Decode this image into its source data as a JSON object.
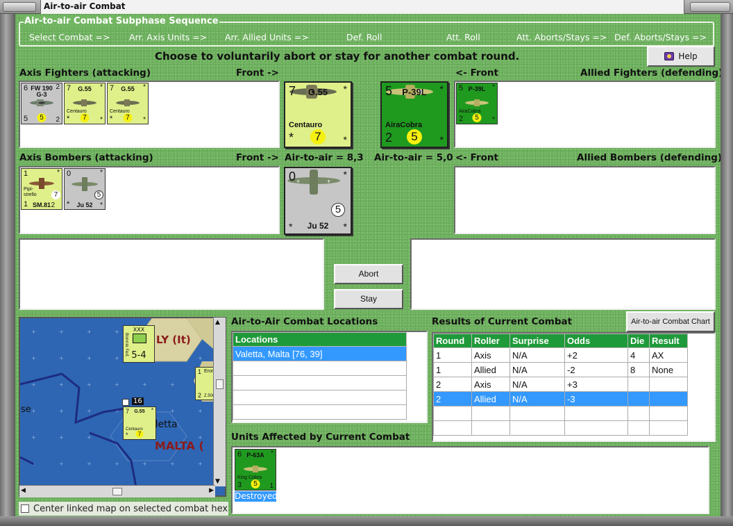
{
  "window": {
    "title": "Air-to-air Combat"
  },
  "subphase": {
    "title": "Air-to-air Combat Subphase Sequence",
    "steps": [
      "Select Combat =>",
      "Arr. Axis Units =>",
      "Arr. Allied Units =>",
      "Def. Roll",
      "Att. Roll",
      "Att. Aborts/Stays =>",
      "Def. Aborts/Stays =>"
    ]
  },
  "instruction": "Choose to voluntarily abort or stay for another combat round.",
  "help_label": "Help",
  "labels": {
    "axis_fighters": "Axis Fighters (attacking)",
    "allied_fighters": "Allied Fighters (defending)",
    "axis_bombers": "Axis Bombers (attacking)",
    "allied_bombers": "Allied Bombers (defending)",
    "front_right": "Front ->",
    "front_left": "<- Front",
    "axis_air_to_air": "Air-to-air = 8,3",
    "allied_air_to_air": "Air-to-air = 5,0"
  },
  "axis_fighters": [
    {
      "name": "FW 190\nG-3",
      "tl": "6",
      "tr": "2",
      "bl": "5",
      "br": "2",
      "circle": "5",
      "sub": "",
      "color": "grey"
    },
    {
      "name": "G.55",
      "tl": "7",
      "tr": "*",
      "bl": "*",
      "br": "*",
      "circle": "7",
      "sub": "Centauro",
      "color": "yellow"
    },
    {
      "name": "G.55",
      "tl": "7",
      "tr": "*",
      "bl": "*",
      "br": "*",
      "circle": "7",
      "sub": "Centauro",
      "color": "yellow"
    }
  ],
  "axis_front_fighter": {
    "name": "G.55",
    "tl": "7",
    "tr": "*",
    "bl": "*",
    "br": "*",
    "circle": "7",
    "sub": "Centauro"
  },
  "allied_front_fighter": {
    "name": "P-39L",
    "tl": "5",
    "tr": "*",
    "bl": "2",
    "br": "*",
    "circle": "5",
    "sub": "AiraCobra"
  },
  "allied_fighters": [
    {
      "name": "P-39L",
      "tl": "5",
      "tr": "*",
      "bl": "2",
      "br": "*",
      "circle": "5",
      "sub": "AiraCobra"
    }
  ],
  "axis_bombers": [
    {
      "name": "SM.81",
      "tl": "1",
      "tr": "*",
      "bl": "1",
      "br": "2",
      "circle": "7",
      "sub": "Pipi-\nstrello",
      "color": "yellow"
    },
    {
      "name": "Ju 52",
      "tl": "0",
      "tr": "*",
      "bl": "*",
      "br": "*",
      "circle": "5",
      "sub": "",
      "color": "grey"
    }
  ],
  "axis_front_bomber": {
    "name": "Ju 52",
    "tl": "0",
    "tr": "*",
    "bl": "*",
    "br": "*",
    "circle": "5"
  },
  "buttons": {
    "abort": "Abort",
    "stay": "Stay",
    "chart": "Air-to-air Combat Chart"
  },
  "map": {
    "region_label": "LY (It)",
    "malta_label": "MALTA (",
    "valetta_label": "aletta",
    "se_label": "se",
    "unit_xxx": "XXX",
    "unit_strength": "5-4",
    "unit_side": "Bonnie Fed.",
    "stack_count": "16",
    "stack_unit": {
      "name": "G.55",
      "tl": "7",
      "tr": "*",
      "bl": "*",
      "circle": "7",
      "sub": "Centauro"
    },
    "edge_unit": {
      "name": "Erone",
      "tl": "1",
      "bl": "2",
      "sub": "Z.506B"
    }
  },
  "checkbox_label": "Center linked map on selected combat hex",
  "locations": {
    "title": "Air-to-Air Combat Locations",
    "header": "Locations",
    "rows": [
      "Valetta, Malta [76, 39]",
      "",
      "",
      "",
      ""
    ]
  },
  "results": {
    "title": "Results of Current Combat",
    "headers": [
      "Round",
      "Roller",
      "Surprise",
      "Odds",
      "Die",
      "Result"
    ],
    "rows": [
      [
        "1",
        "Axis",
        "N/A",
        "+2",
        "4",
        "AX"
      ],
      [
        "1",
        "Allied",
        "N/A",
        "-2",
        "8",
        "None"
      ],
      [
        "2",
        "Axis",
        "N/A",
        "+3",
        "",
        ""
      ],
      [
        "2",
        "Allied",
        "N/A",
        "-3",
        "",
        ""
      ],
      [
        "",
        "",
        "",
        "",
        "",
        ""
      ],
      [
        "",
        "",
        "",
        "",
        "",
        ""
      ]
    ],
    "selected_row": 3
  },
  "affected": {
    "title": "Units Affected by Current Combat",
    "unit": {
      "name": "P-63A",
      "tl": "6",
      "tr": "*",
      "bl": "3",
      "br": "1",
      "circle": "5",
      "sub": "King Cobra"
    },
    "status": "Destroyed"
  },
  "colors": {
    "felt_green": "#72b562",
    "counter_yellow": "#dff08a",
    "counter_green": "#1f9a1f",
    "counter_grey": "#c6c6c6",
    "header_green": "#1f9a3a",
    "selection_blue": "#3399ff",
    "sea_blue": "#2e66b4"
  }
}
